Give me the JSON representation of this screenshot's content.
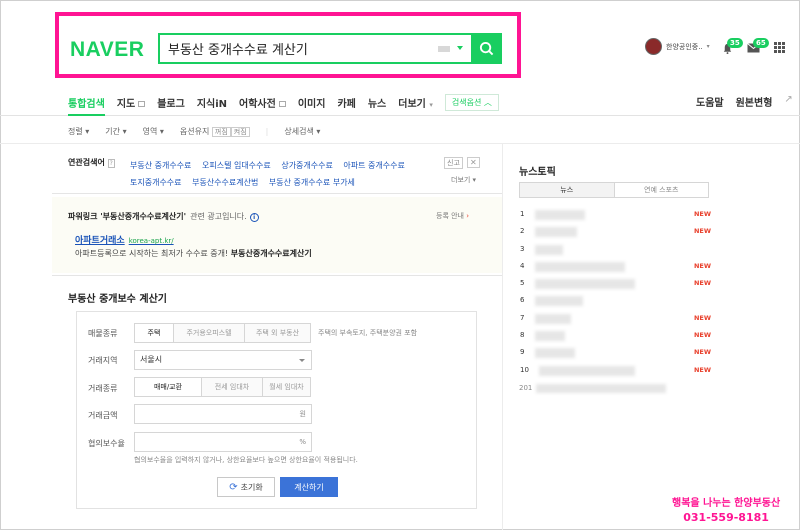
{
  "header": {
    "logo": "NAVER",
    "search_value": "부동산 중개수수료 계산기",
    "username": "한양공인중..",
    "bell_count": "35",
    "mail_count": "65"
  },
  "tabs": {
    "items": [
      "통합검색",
      "지도",
      "블로그",
      "지식iN",
      "어학사전",
      "이미지",
      "카페",
      "뉴스",
      "더보기"
    ],
    "options": "검색옵션",
    "right": [
      "도움말",
      "원본변형"
    ]
  },
  "filters": {
    "items": [
      "정렬",
      "기간",
      "영역",
      "옵션유지",
      "상세검색"
    ],
    "keep_on": "꺼짐",
    "keep_off": "켜짐"
  },
  "related": {
    "title": "연관검색어",
    "links": [
      "부동산 중개수수료",
      "오피스텔 임대수수료",
      "상가중개수수료",
      "아파트 중개수수료",
      "토지중개수수료",
      "부동산수수료계산법",
      "부동산 중개수수료 부가세"
    ],
    "report": "신고",
    "more": "더보기"
  },
  "powerlink": {
    "title": "파워링크 '부동산중개수수료계산기'",
    "subtitle": "관련 광고입니다.",
    "register": "등록 안내",
    "ad_name": "아파트거래소",
    "ad_url": "korea-apt.kr/",
    "ad_desc": "아파트등록으로 시작하는 최저가 수수료 중개!",
    "ad_desc_bold": "부동산중개수수료계산기"
  },
  "calculator": {
    "title": "부동산 중개보수 계산기",
    "property_label": "매물종류",
    "property_options": [
      "주택",
      "주거용오피스텔",
      "주택 외 부동산"
    ],
    "property_note": "주택의 부속토지, 주택분양권 포함",
    "region_label": "거래지역",
    "region_value": "서울시",
    "deal_label": "거래종류",
    "deal_options": [
      "매매/교환",
      "전세 임대차",
      "월세 임대차"
    ],
    "amount_label": "거래금액",
    "amount_unit": "원",
    "fee_label": "협의보수율",
    "fee_unit": "%",
    "fee_note": "협의보수율을 입력하지 않거나, 상한요율보다 높으면 상한요율이 적용됩니다.",
    "reset_label": "초기화",
    "calc_label": "계산하기"
  },
  "news_topic": {
    "title": "뉴스토픽",
    "tabs": [
      "뉴스",
      "연예 스포츠"
    ],
    "rows": [
      {
        "num": "1",
        "new": "NEW"
      },
      {
        "num": "2",
        "new": "NEW"
      },
      {
        "num": "3",
        "new": ""
      },
      {
        "num": "4",
        "new": "NEW"
      },
      {
        "num": "5",
        "new": "NEW"
      },
      {
        "num": "6",
        "new": ""
      },
      {
        "num": "7",
        "new": "NEW"
      },
      {
        "num": "8",
        "new": "NEW"
      },
      {
        "num": "9",
        "new": "NEW"
      },
      {
        "num": "10",
        "new": "NEW"
      }
    ],
    "date_prefix": "201"
  },
  "watermark": {
    "line1": "행복을 나누는 한양부동산",
    "line2": "031-559-8181"
  },
  "colors": {
    "naver_green": "#19ce60",
    "highlight_pink": "#ff1493",
    "link_blue": "#1a53b8",
    "new_red": "#e8412d",
    "calc_button": "#3b73d8"
  }
}
